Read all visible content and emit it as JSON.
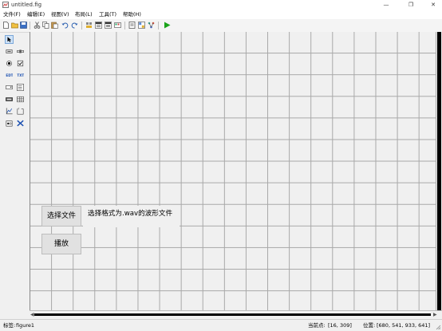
{
  "window": {
    "title": "untitled.fig",
    "minimize_glyph": "—",
    "maximize_glyph": "❐",
    "close_glyph": "✕"
  },
  "menu": {
    "items": [
      {
        "label": "文件(F)"
      },
      {
        "label": "编辑(E)"
      },
      {
        "label": "视图(V)"
      },
      {
        "label": "布局(L)"
      },
      {
        "label": "工具(T)"
      },
      {
        "label": "帮助(H)"
      }
    ]
  },
  "toolbar": {
    "icons": [
      "new-file-icon",
      "open-folder-icon",
      "save-icon",
      "cut-icon",
      "copy-icon",
      "paste-icon",
      "undo-icon",
      "redo-icon",
      "align-objects-icon",
      "menu-editor-icon",
      "tab-order-editor-icon",
      "toolbar-editor-icon",
      "editor-icon",
      "property-inspector-icon",
      "object-browser-icon",
      "run-figure-icon"
    ]
  },
  "palette": {
    "tools": [
      "select-tool-icon",
      "push-button-icon",
      "slider-icon",
      "radio-button-icon",
      "checkbox-icon",
      "edit-text-icon",
      "static-text-icon",
      "popup-menu-icon",
      "listbox-icon",
      "toggle-button-icon",
      "table-icon",
      "axes-icon",
      "panel-icon",
      "button-group-icon",
      "activex-control-icon"
    ]
  },
  "canvas": {
    "choose_file_button": "选择文件",
    "play_button": "播放",
    "hint_text": "选择格式为.wav的波形文件"
  },
  "status": {
    "tag_label": "标签:",
    "tag_value": "figure1",
    "current_point_label": "当前点:",
    "current_point_value": "[16, 309]",
    "position_label": "位置:",
    "position_value": "[680, 541, 933, 641]"
  },
  "colors": {
    "accent_selected": "#cfe3f8",
    "run_green": "#1aa31a",
    "grid_line": "#a8a8a8"
  }
}
